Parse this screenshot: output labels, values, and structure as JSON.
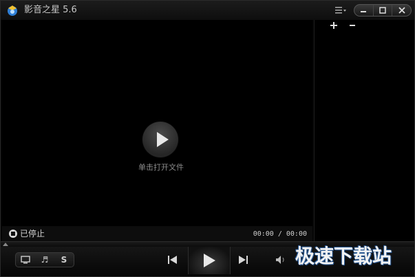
{
  "window": {
    "title": "影音之星 5.6"
  },
  "video": {
    "open_file_label": "单击打开文件"
  },
  "playlist": {
    "add_label": "+",
    "remove_label": "−"
  },
  "status": {
    "state_text": "已停止",
    "time_text": "00:00 / 00:00"
  },
  "controls": {
    "mode_buttons": [
      {
        "icon": "screen-icon",
        "label": ""
      },
      {
        "icon": "music-note-icon",
        "label": "♬"
      },
      {
        "icon": "subtitle-icon",
        "label": "S"
      }
    ]
  },
  "watermark": {
    "text": "极速下载站"
  },
  "colors": {
    "background": "#000000",
    "text": "#d0d0d0",
    "watermark_outline": "#2b5c9a"
  }
}
